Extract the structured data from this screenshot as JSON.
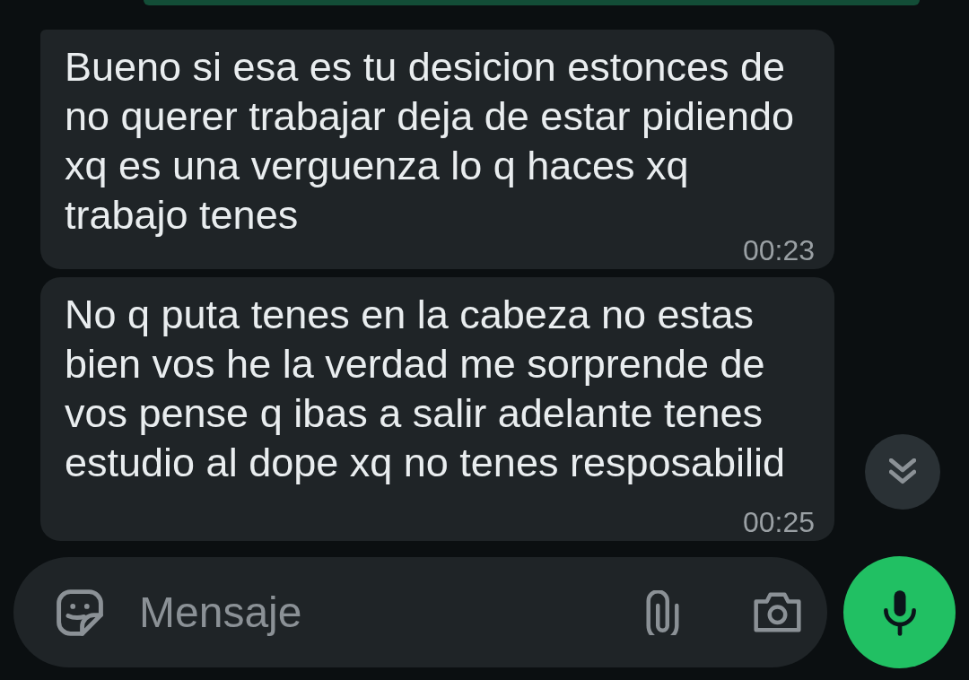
{
  "messages": [
    {
      "kind": "outgoing"
    },
    {
      "kind": "incoming",
      "text": "Bueno si esa es tu desicion estonces de no querer trabajar deja de estar pidiendo xq es una verguenza lo q haces xq trabajo tenes",
      "time": "00:23"
    },
    {
      "kind": "incoming",
      "text": "No q puta tenes en la cabeza no estas bien vos he la verdad me sorprende de vos pense q ibas a salir adelante tenes estudio al dope xq no tenes resposabilid",
      "time": "00:25"
    }
  ],
  "composer": {
    "placeholder": "Mensaje"
  }
}
